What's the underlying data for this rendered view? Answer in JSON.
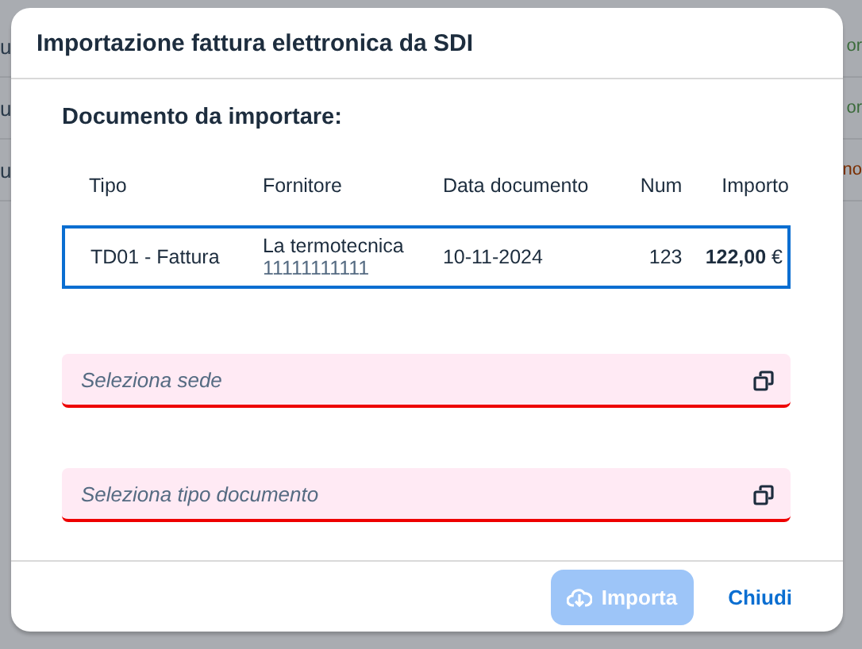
{
  "background_rows": [
    {
      "left": "u",
      "right": "or"
    },
    {
      "left": "u",
      "right": "or"
    },
    {
      "left": "u",
      "right": "no"
    }
  ],
  "dialog": {
    "title": "Importazione fattura elettronica da SDI",
    "section_title": "Documento da importare:",
    "table": {
      "columns": [
        "Tipo",
        "Fornitore",
        "Data documento",
        "Num",
        "Importo"
      ],
      "rows": [
        {
          "selected": true,
          "tipo": "TD01 - Fattura",
          "fornitore": "La termotecnica",
          "fornitore_code": "11111111111",
          "data": "10-11-2024",
          "num": "123",
          "importo": "122,00",
          "currency": "€"
        }
      ]
    },
    "fields": [
      {
        "placeholder": "Seleziona sede",
        "invalid": true
      },
      {
        "placeholder": "Seleziona tipo documento",
        "invalid": true
      }
    ],
    "buttons": [
      {
        "label": "Importa",
        "kind": "primary",
        "disabled": true
      },
      {
        "label": "Chiudi",
        "kind": "link",
        "disabled": false
      }
    ]
  }
}
